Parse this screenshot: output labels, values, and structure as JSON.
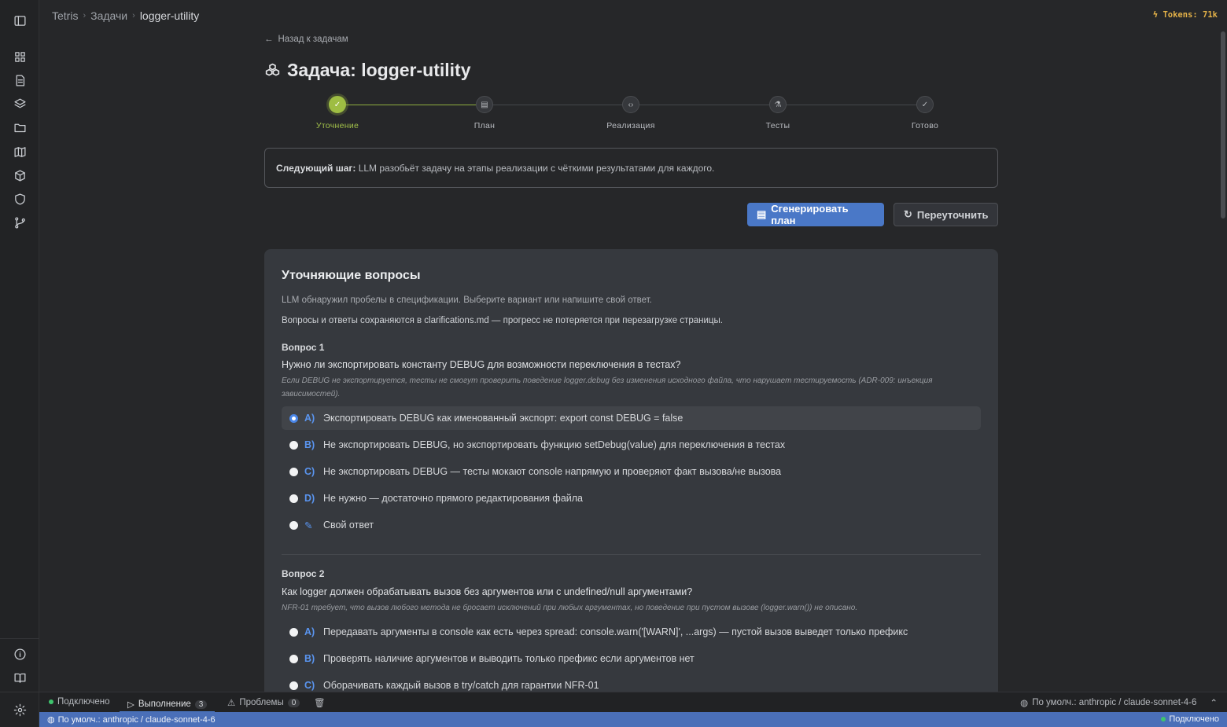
{
  "breadcrumb": [
    "Tetris",
    "Задачи",
    "logger-utility"
  ],
  "tokens": "Tokens: 71k",
  "back_link": "Назад к задачам",
  "page_title": "Задача: logger-utility",
  "steps": [
    {
      "label": "Уточнение",
      "state": "done"
    },
    {
      "label": "План",
      "state": "pending"
    },
    {
      "label": "Реализация",
      "state": "pending"
    },
    {
      "label": "Тесты",
      "state": "pending"
    },
    {
      "label": "Готово",
      "state": "pending"
    }
  ],
  "next_step": {
    "label": "Следующий шаг:",
    "text": " LLM разобьёт задачу на этапы реализации с чёткими результатами для каждого."
  },
  "buttons": {
    "generate_plan": "Сгенерировать план",
    "reclarify": "Переуточнить"
  },
  "clarify": {
    "title": "Уточняющие вопросы",
    "desc1": "LLM обнаружил пробелы в спецификации. Выберите вариант или напишите свой ответ.",
    "desc2": "Вопросы и ответы сохраняются в clarifications.md — прогресс не потеряется при перезагрузке страницы.",
    "questions": [
      {
        "label": "Вопрос 1",
        "text": "Нужно ли экспортировать константу DEBUG для возможности переключения в тестах?",
        "note": "Если DEBUG не экспортируется, тесты не смогут проверить поведение logger.debug без изменения исходного файла, что нарушает тестируемость (ADR-009: инъекция зависимостей).",
        "options": [
          {
            "key": "A)",
            "text": "Экспортировать DEBUG как именованный экспорт: export const DEBUG = false",
            "selected": true
          },
          {
            "key": "B)",
            "text": "Не экспортировать DEBUG, но экспортировать функцию setDebug(value) для переключения в тестах",
            "selected": false
          },
          {
            "key": "C)",
            "text": "Не экспортировать DEBUG — тесты мокают console напрямую и проверяют факт вызова/не вызова",
            "selected": false
          },
          {
            "key": "D)",
            "text": "Не нужно — достаточно прямого редактирования файла",
            "selected": false
          },
          {
            "key": "",
            "text": "Свой ответ",
            "selected": false
          }
        ]
      },
      {
        "label": "Вопрос 2",
        "text": "Как logger должен обрабатывать вызов без аргументов или с undefined/null аргументами?",
        "note": "NFR-01 требует, что вызов любого метода не бросает исключений при любых аргументах, но поведение при пустом вызове (logger.warn()) не описано.",
        "options": [
          {
            "key": "A)",
            "text": "Передавать аргументы в console как есть через spread: console.warn('[WARN]', ...args) — пустой вызов выведет только префикс",
            "selected": false
          },
          {
            "key": "B)",
            "text": "Проверять наличие аргументов и выводить только префикс если аргументов нет",
            "selected": false
          },
          {
            "key": "C)",
            "text": "Оборачивать каждый вызов в try/catch для гарантии NFR-01",
            "selected": false
          }
        ]
      }
    ]
  },
  "panelbar": {
    "connected": "Подключено",
    "run_tab": "Выполнение",
    "run_count": "3",
    "problems_tab": "Проблемы",
    "problems_count": "0",
    "model": "По умолч.: anthropic / claude-sonnet-4-6"
  },
  "statusbar": {
    "model": "По умолч.: anthropic / claude-sonnet-4-6",
    "connected": "Подключено"
  }
}
